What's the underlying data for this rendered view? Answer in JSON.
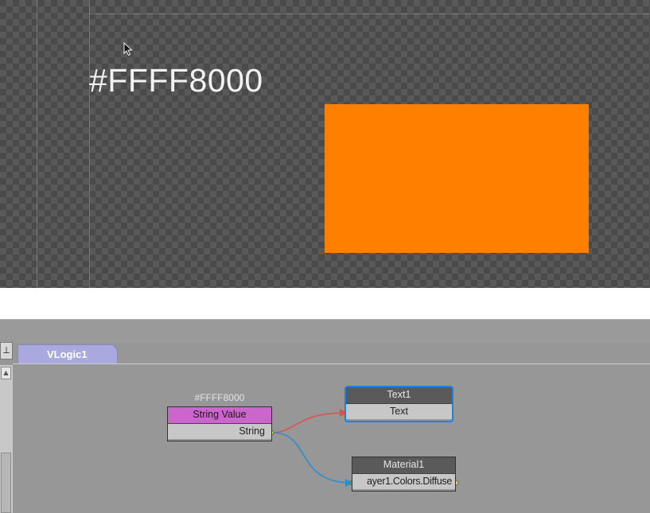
{
  "preview": {
    "display_text": "#FFFF8000",
    "rect_color": "#FF8000"
  },
  "editor": {
    "tab_label": "VLogic1",
    "pin_icon": "pin-icon",
    "scroll_up_icon": "arrow-up-icon"
  },
  "nodes": {
    "string_value": {
      "caption": "#FFFF8000",
      "title": "String Value",
      "output_label": "String",
      "header_color": "#CC66CC"
    },
    "text1": {
      "title": "Text1",
      "input_label": "Text",
      "selected_color": "#1F7FE6"
    },
    "material1": {
      "title": "Material1",
      "input_label": "ayer1.Colors.Diffuse"
    }
  },
  "wires": {
    "to_text_color": "#E0504A",
    "to_material_color": "#2A8FD0"
  }
}
